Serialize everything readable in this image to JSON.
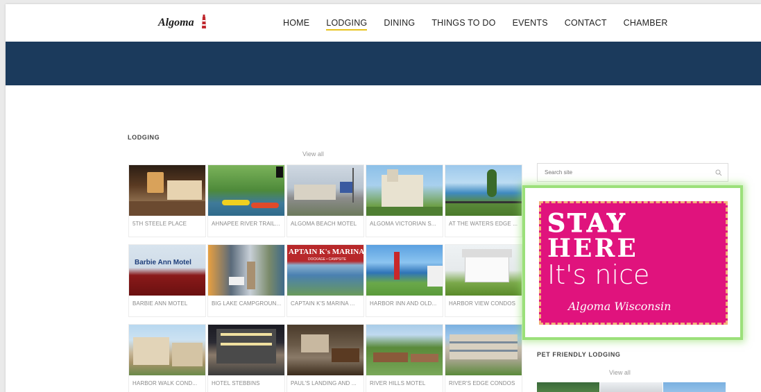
{
  "site": {
    "logo_text": "Algoma"
  },
  "nav": {
    "items": [
      {
        "label": "HOME",
        "active": false
      },
      {
        "label": "LODGING",
        "active": true
      },
      {
        "label": "DINING",
        "active": false
      },
      {
        "label": "THINGS TO DO",
        "active": false
      },
      {
        "label": "EVENTS",
        "active": false
      },
      {
        "label": "CONTACT",
        "active": false
      },
      {
        "label": "CHAMBER",
        "active": false
      }
    ]
  },
  "lodging": {
    "title": "LODGING",
    "view_all": "View all",
    "items": [
      "5TH STEELE PLACE",
      "AHNAPEE RIVER TRAIL...",
      "ALGOMA BEACH MOTEL",
      "ALGOMA VICTORIAN S...",
      "AT THE WATERS EDGE ...",
      "BARBIE ANN MOTEL",
      "BIG LAKE CAMPGROUN...",
      "CAPTAIN K'S MARINA ...",
      "HARBOR INN AND OLD...",
      "HARBOR VIEW CONDOS",
      "HARBOR WALK COND...",
      "HOTEL STEBBINS",
      "PAUL'S LANDING AND ...",
      "RIVER HILLS MOTEL",
      "RIVER'S EDGE CONDOS"
    ],
    "photo_text": {
      "barbie_sign": "Barbie Ann Motel",
      "captain_sign": "APTAIN K's MARINA",
      "captain_sub": "DOCKAGE • CAMPSITE"
    }
  },
  "sidebar": {
    "search_placeholder": "Search site",
    "ad": {
      "line1": "STAY",
      "line2": "HERE",
      "line3": "It's nice",
      "line4": "Algoma Wisconsin"
    },
    "pet_title": "PET FRIENDLY LODGING",
    "pet_view_all": "View all"
  },
  "colors": {
    "banner": "#1b3a5c",
    "accent_underline": "#e8c21d",
    "ad_pink": "#e0137d",
    "ad_glow": "#9be07a"
  }
}
